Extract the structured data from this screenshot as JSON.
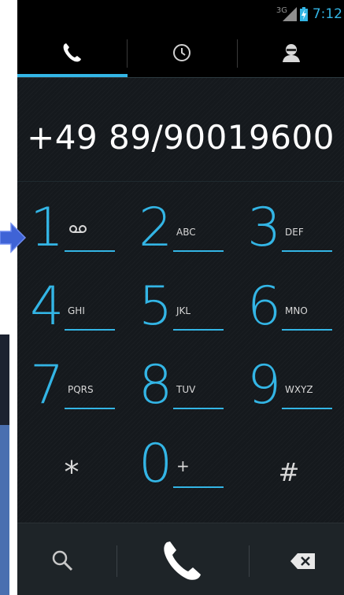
{
  "status_bar": {
    "network": "3G",
    "time": "7:12",
    "accent_color": "#33b5e5"
  },
  "tabs": [
    {
      "icon": "phone-icon",
      "selected": true
    },
    {
      "icon": "clock-icon",
      "selected": false
    },
    {
      "icon": "contact-icon",
      "selected": false
    }
  ],
  "display": {
    "number": "+49 89/90019600"
  },
  "keypad": [
    {
      "digit": "1",
      "letters": "",
      "icon": "voicemail-icon"
    },
    {
      "digit": "2",
      "letters": "ABC"
    },
    {
      "digit": "3",
      "letters": "DEF"
    },
    {
      "digit": "4",
      "letters": "GHI"
    },
    {
      "digit": "5",
      "letters": "JKL"
    },
    {
      "digit": "6",
      "letters": "MNO"
    },
    {
      "digit": "7",
      "letters": "PQRS"
    },
    {
      "digit": "8",
      "letters": "TUV"
    },
    {
      "digit": "9",
      "letters": "WXYZ"
    },
    {
      "digit": "*",
      "letters": ""
    },
    {
      "digit": "0",
      "letters": "+"
    },
    {
      "digit": "#",
      "letters": ""
    }
  ],
  "bottom_bar": {
    "search_icon": "search-icon",
    "call_icon": "call-icon",
    "delete_icon": "backspace-icon"
  }
}
